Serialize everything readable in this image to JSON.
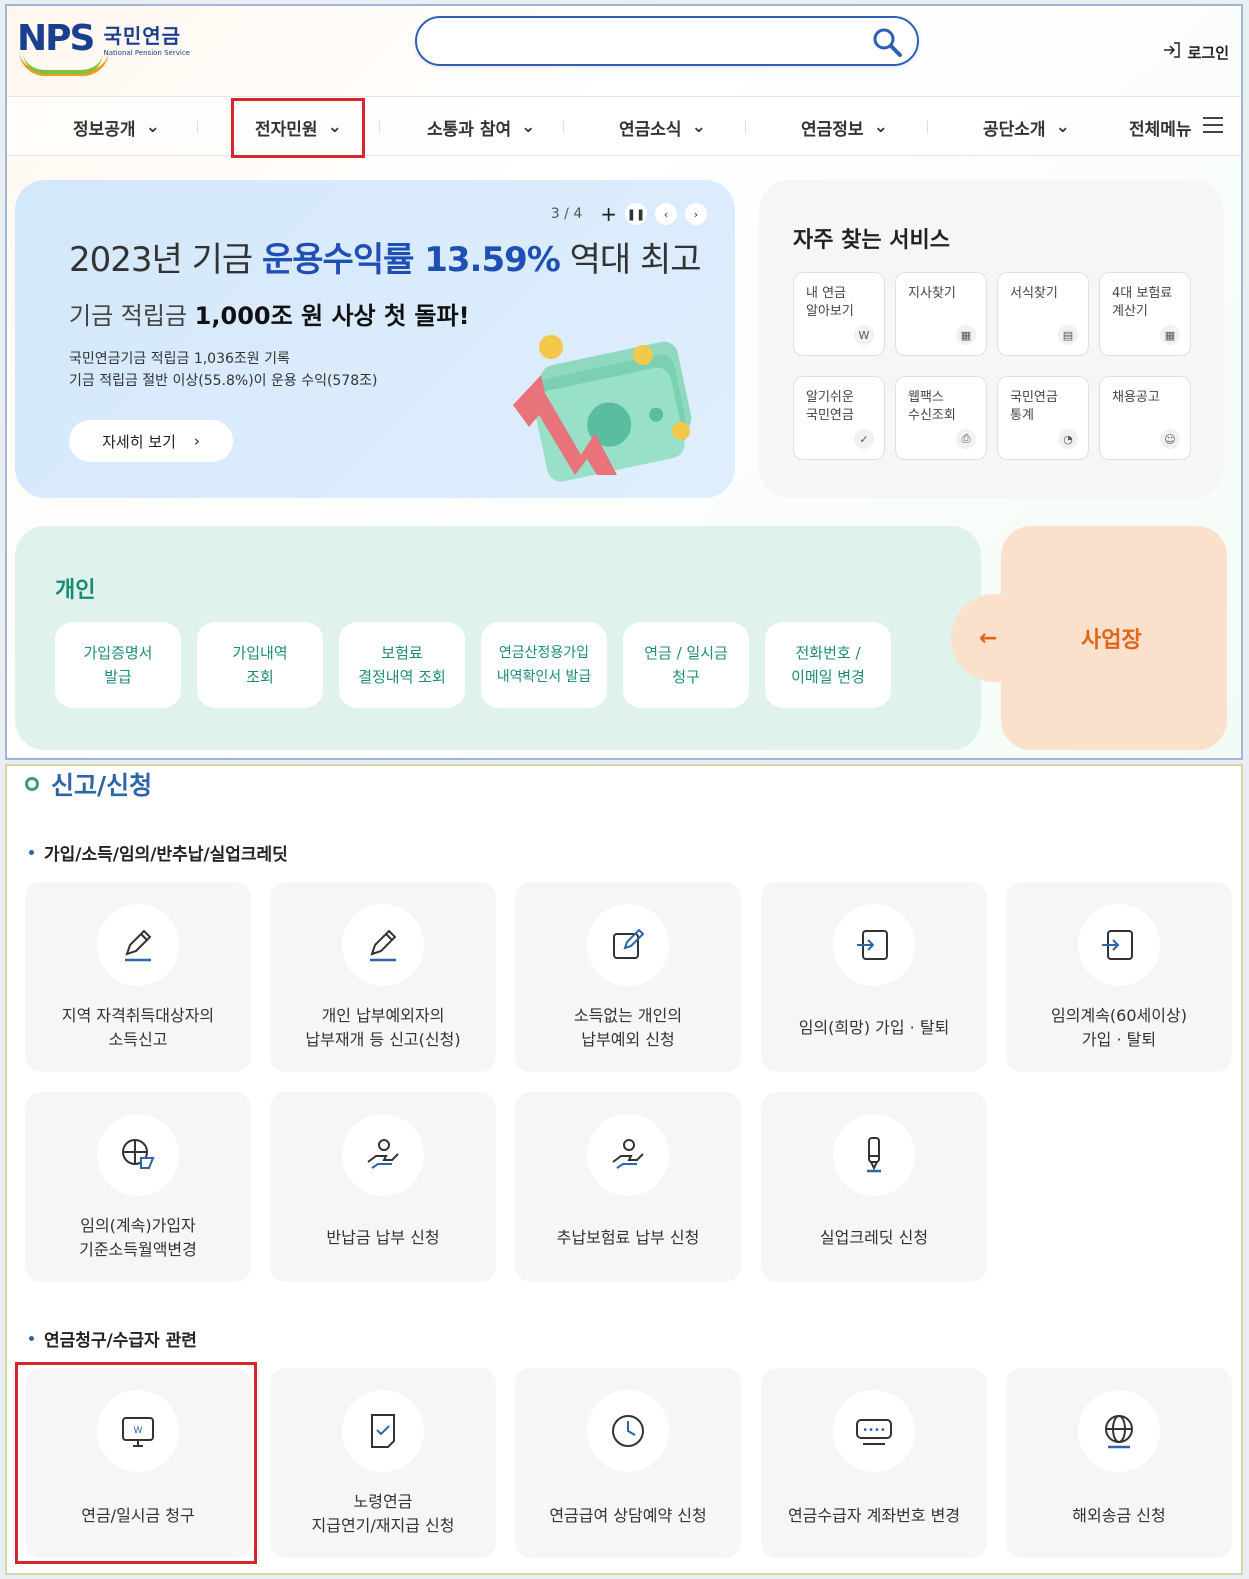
{
  "header": {
    "logo_mark": "NPS",
    "logo_ko": "국민연금",
    "logo_en": "National Pension Service",
    "search_placeholder": "",
    "login_label": "로그인"
  },
  "nav": {
    "items": [
      "정보공개",
      "전자민원",
      "소통과 참여",
      "연금소식",
      "연금정보",
      "공단소개"
    ],
    "all_menu": "전체메뉴"
  },
  "banner": {
    "pager": "3 / 4",
    "title_pre": "2023년 기금 ",
    "title_hl": "운용수익률 13.59%",
    "title_post": " 역대 최고",
    "sub_pre": "기금 적립금 ",
    "sub_bold": "1,000조 원 사상 첫 돌파!",
    "line1": "국민연금기금 적립금 1,036조원 기록",
    "line2": "기금 적립금 절반 이상(55.8%)이 운용 수익(578조)",
    "more_label": "자세히 보기"
  },
  "frequent": {
    "title": "자주 찾는 서비스",
    "items": [
      {
        "label": "내 연금\n알아보기",
        "icon": "W"
      },
      {
        "label": "지사찾기",
        "icon": "▦"
      },
      {
        "label": "서식찾기",
        "icon": "▤"
      },
      {
        "label": "4대 보험료\n계산기",
        "icon": "▦"
      },
      {
        "label": "알기쉬운\n국민연금",
        "icon": "✓"
      },
      {
        "label": "웹팩스\n수신조회",
        "icon": "⎙"
      },
      {
        "label": "국민연금\n통계",
        "icon": "◔"
      },
      {
        "label": "채용공고",
        "icon": "☺"
      }
    ]
  },
  "personal": {
    "title": "개인",
    "buttons": [
      "가입증명서\n발급",
      "가입내역\n조회",
      "보험료\n결정내역 조회",
      "연금산정용가입\n내역확인서 발급",
      "연금 / 일시금\n청구",
      "전화번호 /\n이메일 변경"
    ],
    "business_label": "사업장",
    "business_arrow": "←"
  },
  "report": {
    "title": "신고/신청",
    "group1_title": "가입/소득/임의/반추납/실업크레딧",
    "group1_items": [
      "지역 자격취득대상자의\n소득신고",
      "개인 납부예외자의\n납부재개 등 신고(신청)",
      "소득없는 개인의\n납부예외 신청",
      "임의(희망) 가입 · 탈퇴",
      "임의계속(60세이상)\n가입 · 탈퇴",
      "임의(계속)가입자\n기준소득월액변경",
      "반납금 납부 신청",
      "추납보험료 납부 신청",
      "실업크레딧 신청"
    ],
    "group2_title": "연금청구/수급자 관련",
    "group2_items": [
      "연금/일시금 청구",
      "노령연금\n지급연기/재지급 신청",
      "연금급여 상담예약 신청",
      "연금수급자 계좌번호 변경",
      "해외송금 신청"
    ]
  },
  "colors": {
    "highlight_box": "#d8262e",
    "brand_blue": "#1b3f8f",
    "accent_teal": "#198a75",
    "accent_orange": "#e1651b"
  }
}
